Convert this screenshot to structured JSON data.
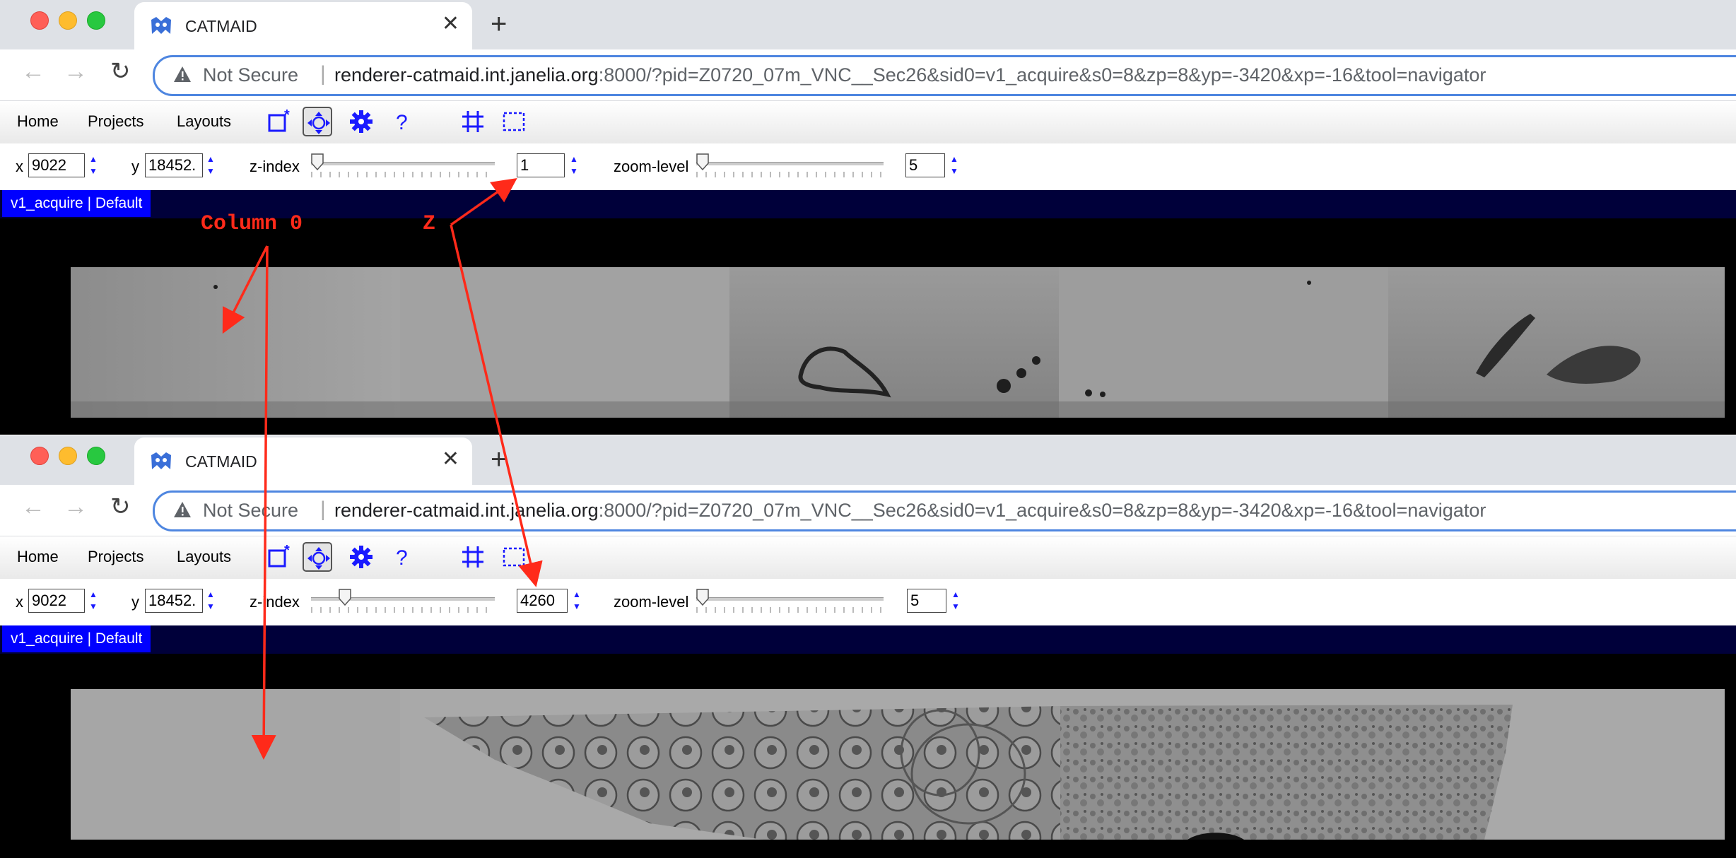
{
  "browser": {
    "tab_title": "CATMAID",
    "tab_close": "✕",
    "new_tab": "+",
    "security_label": "Not Secure",
    "url_host": "renderer-catmaid.int.janelia.org",
    "url_rest": ":8000/?pid=Z0720_07m_VNC__Sec26&sid0=v1_acquire&s0=8&zp=8&yp=-3420&xp=-16&tool=navigator",
    "back_icon": "back-arrow-icon",
    "forward_icon": "forward-arrow-icon",
    "reload_icon": "reload-icon"
  },
  "menu": {
    "home": "Home",
    "projects": "Projects",
    "layouts": "Layouts"
  },
  "toolbar": {
    "tools": [
      "new-window-icon",
      "navigator-icon",
      "settings-gear-icon",
      "help-icon",
      "tile-grid-icon",
      "selection-box-icon"
    ],
    "active_tool": "navigator-icon",
    "accent_color": "#1a1aff"
  },
  "nav_labels": {
    "x": "x",
    "y": "y",
    "z_index": "z-index",
    "zoom_level": "zoom-level"
  },
  "windows": [
    {
      "x_value": "9022",
      "y_value": "18452.",
      "z_index_value": "1",
      "z_slider_fraction": 0.0,
      "zoom_level_value": "5",
      "layer_label": "v1_acquire | Default"
    },
    {
      "x_value": "9022",
      "y_value": "18452.",
      "z_index_value": "4260",
      "z_slider_fraction": 0.16,
      "zoom_level_value": "5",
      "layer_label": "v1_acquire | Default"
    }
  ],
  "annotations": {
    "column_label": "Column 0",
    "z_label": "Z",
    "color": "#ff2a1a"
  },
  "colors": {
    "layer_bar": "#00003a",
    "layer_label_bg": "#0000ff",
    "omnibox_border": "#4e86e0",
    "tab_strip": "#dee1e6"
  }
}
